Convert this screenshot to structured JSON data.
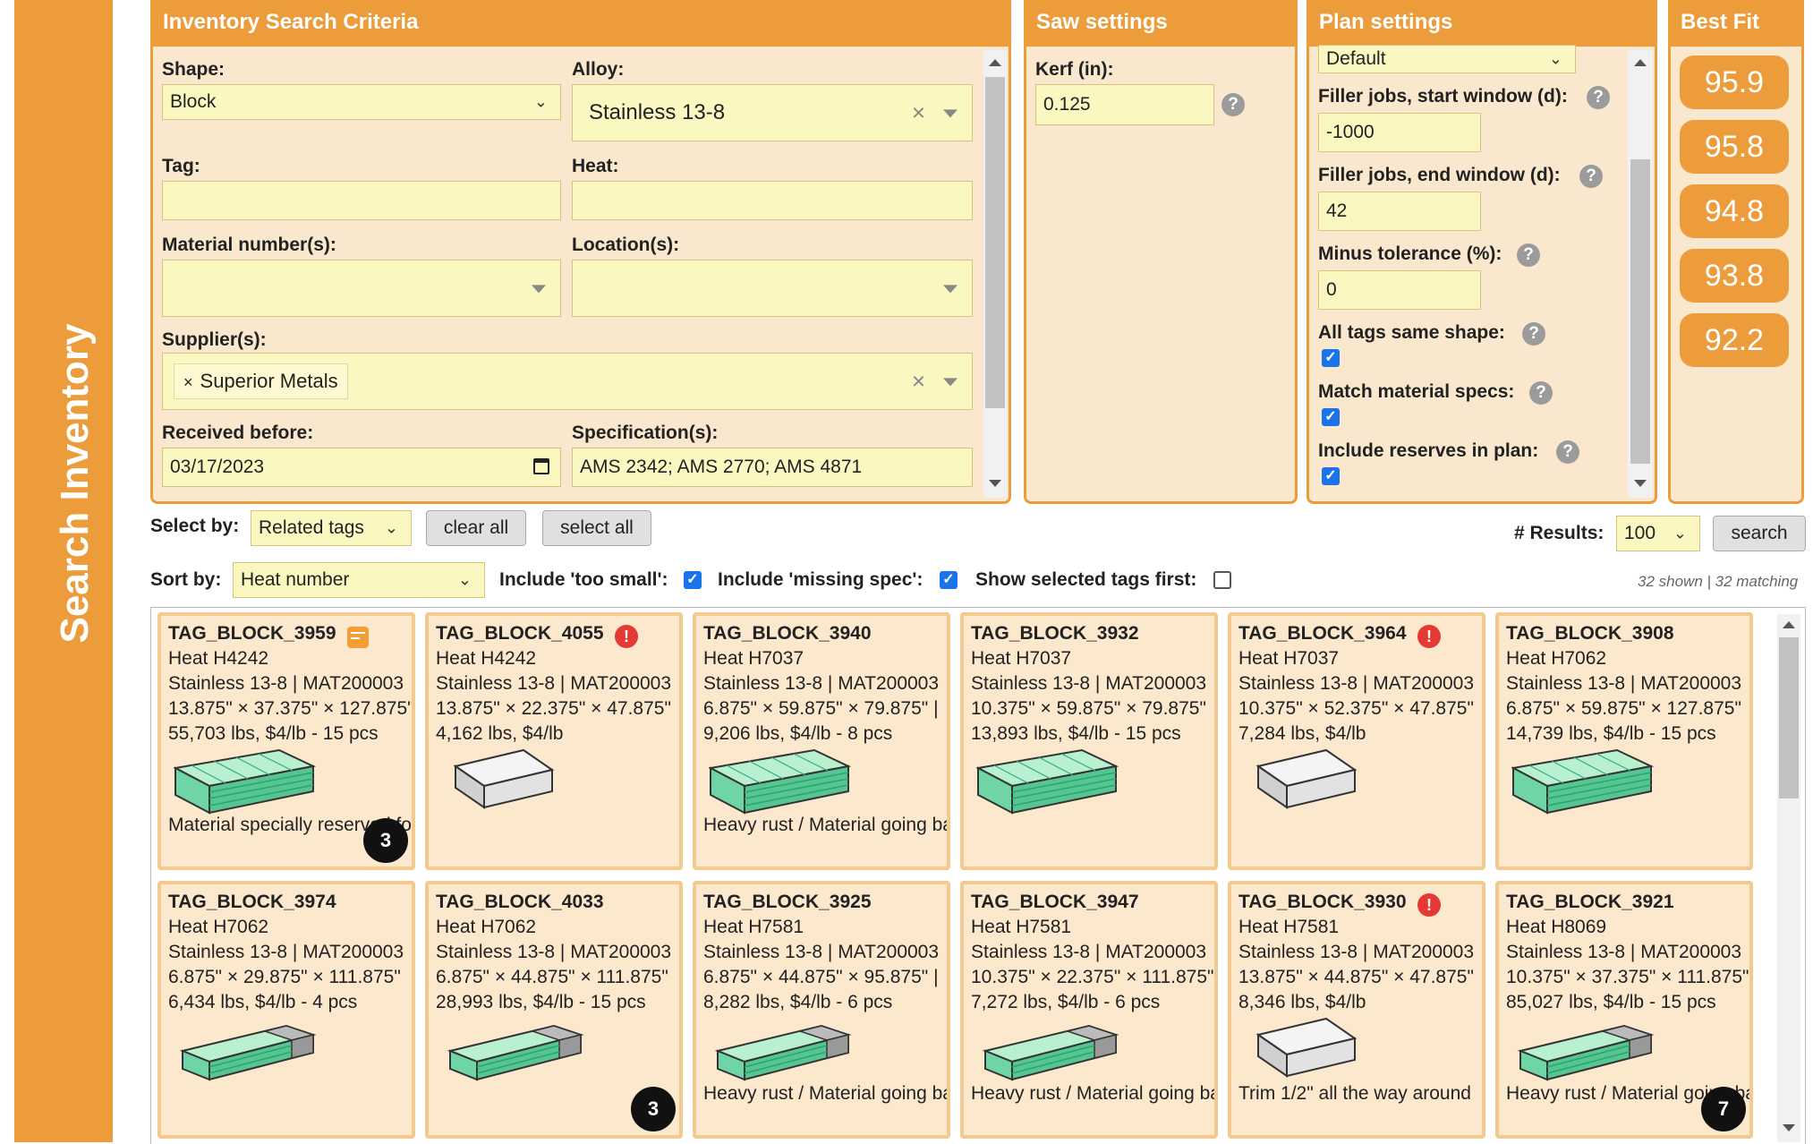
{
  "sidebar": {
    "title": "Search Inventory"
  },
  "criteria": {
    "title": "Inventory Search Criteria",
    "shape_label": "Shape:",
    "shape_value": "Block",
    "alloy_label": "Alloy:",
    "alloy_value": "Stainless 13-8",
    "tag_label": "Tag:",
    "tag_value": "",
    "heat_label": "Heat:",
    "heat_value": "",
    "material_label": "Material number(s):",
    "material_value": "",
    "location_label": "Location(s):",
    "location_value": "",
    "supplier_label": "Supplier(s):",
    "supplier_tag": "Superior Metals",
    "received_label": "Received before:",
    "received_value": "03/17/2023",
    "spec_label": "Specification(s):",
    "spec_value": "AMS 2342; AMS 2770; AMS 4871"
  },
  "saw": {
    "title": "Saw settings",
    "kerf_label": "Kerf (in):",
    "kerf_value": "0.125"
  },
  "plan": {
    "title": "Plan settings",
    "profile_value": "Default",
    "filler_start_label": "Filler jobs, start window (d):",
    "filler_start_value": "-1000",
    "filler_end_label": "Filler jobs, end window (d):",
    "filler_end_value": "42",
    "minus_tol_label": "Minus tolerance (%):",
    "minus_tol_value": "0",
    "same_shape_label": "All tags same shape:",
    "match_specs_label": "Match material specs:",
    "reserves_label": "Include reserves in plan:"
  },
  "bestfit": {
    "title": "Best Fit",
    "scores": [
      "95.9",
      "95.8",
      "94.8",
      "93.8",
      "92.2"
    ]
  },
  "toolbar": {
    "select_by_label": "Select by:",
    "select_by_value": "Related tags",
    "clear_all": "clear all",
    "select_all": "select all",
    "results_label": "# Results:",
    "results_value": "100",
    "search": "search",
    "sort_by_label": "Sort by:",
    "sort_by_value": "Heat number",
    "too_small_label": "Include 'too small':",
    "missing_spec_label": "Include 'missing spec':",
    "selected_first_label": "Show selected tags first:",
    "shown_text": "32 shown | 32 matching"
  },
  "colors": {
    "accent": "#ec9c3a",
    "field": "#fbf7c0",
    "panel": "#f9e8cd",
    "card": "#fbe8cd",
    "alert": "#e53935"
  },
  "cards": [
    {
      "tag": "TAG_BLOCK_3959",
      "heat": "Heat H4242",
      "material": "Stainless 13-8 | MAT200003",
      "dims": "13.875\" × 37.375\" × 127.875\"",
      "weight": "55,703 lbs, $4/lb - 15 pcs",
      "note": "Material specially reserved for",
      "icon": "note-icon",
      "count": "3",
      "style": "stack"
    },
    {
      "tag": "TAG_BLOCK_4055",
      "heat": "Heat H4242",
      "material": "Stainless 13-8 | MAT200003",
      "dims": "13.875\" × 22.375\" × 47.875\"",
      "weight": "4,162 lbs, $4/lb",
      "note": "",
      "icon": "alert-icon",
      "count": "",
      "style": "plain"
    },
    {
      "tag": "TAG_BLOCK_3940",
      "heat": "Heat H7037",
      "material": "Stainless 13-8 | MAT200003",
      "dims": "6.875\" × 59.875\" × 79.875\" | ",
      "weight": "9,206 lbs, $4/lb - 8 pcs",
      "note": "Heavy rust / Material going bad",
      "icon": "",
      "count": "",
      "style": "stack"
    },
    {
      "tag": "TAG_BLOCK_3932",
      "heat": "Heat H7037",
      "material": "Stainless 13-8 | MAT200003",
      "dims": "10.375\" × 59.875\" × 79.875\"",
      "weight": "13,893 lbs, $4/lb - 15 pcs",
      "note": "",
      "icon": "",
      "count": "",
      "style": "stack"
    },
    {
      "tag": "TAG_BLOCK_3964",
      "heat": "Heat H7037",
      "material": "Stainless 13-8 | MAT200003",
      "dims": "10.375\" × 52.375\" × 47.875\"",
      "weight": "7,284 lbs, $4/lb",
      "note": "",
      "icon": "alert-icon",
      "count": "",
      "style": "plain"
    },
    {
      "tag": "TAG_BLOCK_3908",
      "heat": "Heat H7062",
      "material": "Stainless 13-8 | MAT200003",
      "dims": "6.875\" × 59.875\" × 127.875\"",
      "weight": "14,739 lbs, $4/lb - 15 pcs",
      "note": "",
      "icon": "",
      "count": "",
      "style": "stack"
    },
    {
      "tag": "TAG_BLOCK_3974",
      "heat": "Heat H7062",
      "material": "Stainless 13-8 | MAT200003",
      "dims": "6.875\" × 29.875\" × 111.875\"",
      "weight": "6,434 lbs, $4/lb - 4 pcs",
      "note": "",
      "icon": "",
      "count": "",
      "style": "bar"
    },
    {
      "tag": "TAG_BLOCK_4033",
      "heat": "Heat H7062",
      "material": "Stainless 13-8 | MAT200003",
      "dims": "6.875\" × 44.875\" × 111.875\"",
      "weight": "28,993 lbs, $4/lb - 15 pcs",
      "note": "",
      "icon": "",
      "count": "3",
      "style": "bar"
    },
    {
      "tag": "TAG_BLOCK_3925",
      "heat": "Heat H7581",
      "material": "Stainless 13-8 | MAT200003",
      "dims": "6.875\" × 44.875\" × 95.875\" | ",
      "weight": "8,282 lbs, $4/lb - 6 pcs",
      "note": "Heavy rust / Material going bad",
      "icon": "",
      "count": "",
      "style": "bar"
    },
    {
      "tag": "TAG_BLOCK_3947",
      "heat": "Heat H7581",
      "material": "Stainless 13-8 | MAT200003",
      "dims": "10.375\" × 22.375\" × 111.875\"",
      "weight": "7,272 lbs, $4/lb - 6 pcs",
      "note": "Heavy rust / Material going bad",
      "icon": "",
      "count": "",
      "style": "bar"
    },
    {
      "tag": "TAG_BLOCK_3930",
      "heat": "Heat H7581",
      "material": "Stainless 13-8 | MAT200003",
      "dims": "13.875\" × 44.875\" × 47.875\"",
      "weight": "8,346 lbs, $4/lb",
      "note": "Trim 1/2\" all the way around",
      "icon": "alert-icon",
      "count": "",
      "style": "plain"
    },
    {
      "tag": "TAG_BLOCK_3921",
      "heat": "Heat H8069",
      "material": "Stainless 13-8 | MAT200003",
      "dims": "10.375\" × 37.375\" × 111.875\"",
      "weight": "85,027 lbs, $4/lb - 15 pcs",
      "note": "Heavy rust / Material going bad",
      "icon": "",
      "count": "7",
      "style": "bar"
    }
  ]
}
